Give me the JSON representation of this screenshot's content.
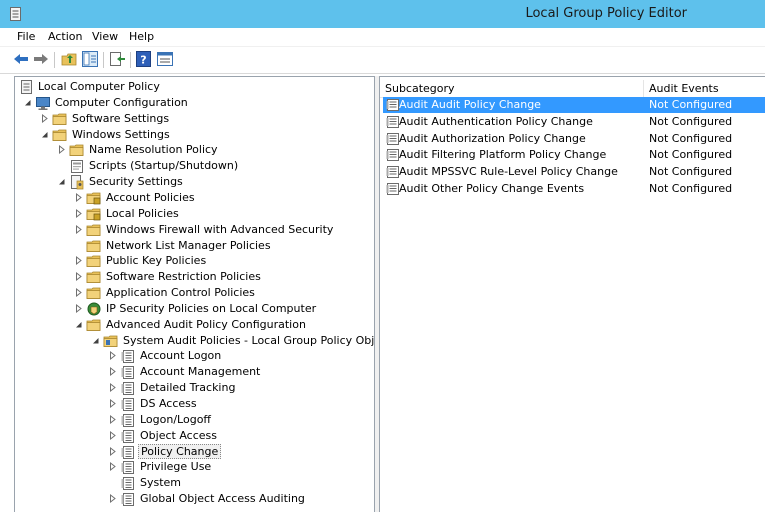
{
  "window": {
    "title": "Local Group Policy Editor"
  },
  "menu": [
    "File",
    "Action",
    "View",
    "Help"
  ],
  "toolbar": {
    "buttons": [
      "back-icon",
      "forward-icon",
      "up-folder-icon",
      "show-hide-tree-icon",
      "export-list-icon",
      "help-icon",
      "properties-icon"
    ]
  },
  "tree": {
    "items": [
      {
        "label": "Local Computer Policy"
      },
      {
        "label": "Computer Configuration"
      },
      {
        "label": "Software Settings"
      },
      {
        "label": "Windows Settings"
      },
      {
        "label": "Name Resolution Policy"
      },
      {
        "label": "Scripts (Startup/Shutdown)"
      },
      {
        "label": "Security Settings"
      },
      {
        "label": "Account Policies"
      },
      {
        "label": "Local Policies"
      },
      {
        "label": "Windows Firewall with Advanced Security"
      },
      {
        "label": "Network List Manager Policies"
      },
      {
        "label": "Public Key Policies"
      },
      {
        "label": "Software Restriction Policies"
      },
      {
        "label": "Application Control Policies"
      },
      {
        "label": "IP Security Policies on Local Computer"
      },
      {
        "label": "Advanced Audit Policy Configuration"
      },
      {
        "label": "System Audit Policies - Local Group Policy Object"
      },
      {
        "label": "Account Logon"
      },
      {
        "label": "Account Management"
      },
      {
        "label": "Detailed Tracking"
      },
      {
        "label": "DS Access"
      },
      {
        "label": "Logon/Logoff"
      },
      {
        "label": "Object Access"
      },
      {
        "label": "Policy Change"
      },
      {
        "label": "Privilege Use"
      },
      {
        "label": "System"
      },
      {
        "label": "Global Object Access Auditing"
      }
    ]
  },
  "list": {
    "columns": [
      "Subcategory",
      "Audit Events"
    ],
    "rows": [
      {
        "subcategory": "Audit Audit Policy Change",
        "audit_events": "Not Configured"
      },
      {
        "subcategory": "Audit Authentication Policy Change",
        "audit_events": "Not Configured"
      },
      {
        "subcategory": "Audit Authorization Policy Change",
        "audit_events": "Not Configured"
      },
      {
        "subcategory": "Audit Filtering Platform Policy Change",
        "audit_events": "Not Configured"
      },
      {
        "subcategory": "Audit MPSSVC Rule-Level Policy Change",
        "audit_events": "Not Configured"
      },
      {
        "subcategory": "Audit Other Policy Change Events",
        "audit_events": "Not Configured"
      }
    ]
  },
  "colors": {
    "titlebar": "#5ec1ec",
    "selection": "#3399ff",
    "folder": "#e8c15a"
  }
}
